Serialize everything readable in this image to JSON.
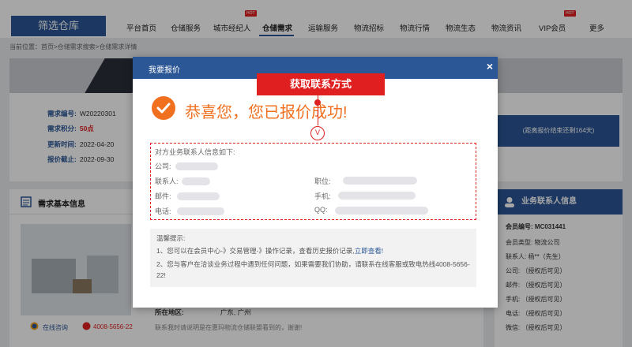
{
  "nav": {
    "logo": "筛选仓库",
    "items": [
      "平台首页",
      "仓储服务",
      "城市经纪人",
      "仓储需求",
      "运输服务",
      "物流招标",
      "物流行情",
      "物流生态",
      "物流资讯",
      "VIP会员",
      "更多"
    ],
    "hot": "HOT"
  },
  "breadcrumb": "当前位置：首页>仓储需求搜索>仓储需求详情",
  "info": {
    "code_label": "需求编号:",
    "code_value": "W20220301",
    "score_label": "需求积分:",
    "score_value": "50点",
    "update_label": "更新时间:",
    "update_value": "2022-04-20",
    "deadline_label": "报价截止:",
    "deadline_value": "2022-09-30"
  },
  "countdown": "(距离报价结束还剩164天)",
  "basic_section_title": "需求基本信息",
  "side": {
    "title": "业务联系人信息",
    "member_label": "会员编号:",
    "member_value": "MC031441",
    "type_label": "会员类型:",
    "type_value": "物流公司",
    "contact_label": "联系人:",
    "contact_value": "杨**（先生）",
    "company_label": "公司:",
    "company_value": "（授权后可见）",
    "email_label": "邮件:",
    "email_value": "（授权后可见）",
    "mobile_label": "手机:",
    "mobile_value": "（授权后可见）",
    "phone_label": "电话:",
    "phone_value": "（授权后可见）",
    "wechat_label": "微信:",
    "wechat_value": "（授权后可见）"
  },
  "bottom": {
    "region_label": "所在地区:",
    "region_value": "广东, 广州",
    "note": "联系我时请说明是在惠玛物流仓储联盟看到的，谢谢!",
    "chat": "在线咨询",
    "phone": "4008-5656-22"
  },
  "modal": {
    "title": "我要报价",
    "close": "×",
    "callout": "获取联系方式",
    "callout_v": "V",
    "success": "恭喜您，您已报价成功!",
    "contact_intro": "对方业务联系人信息如下:",
    "company_label": "公司:",
    "contact_label": "联系人:",
    "position_label": "职位:",
    "email_label": "邮件:",
    "mobile_label": "手机:",
    "phone_label": "电话:",
    "qq_label": "QQ:",
    "tips_title": "温馨提示:",
    "tip1_text": "1、您可以在会员中心-》交易管理-》操作记录，查看历史报价记录,",
    "tip1_link": "立即查看!",
    "tip2_text": "2、您与客户在洽谈业务过程中遇到任何问题，如果需要我们协助，请联系在线客服或致电热线4008-5656-22!"
  },
  "colors": {
    "brand": "#2b5797",
    "accent": "#f07020",
    "alert": "#e02020"
  }
}
